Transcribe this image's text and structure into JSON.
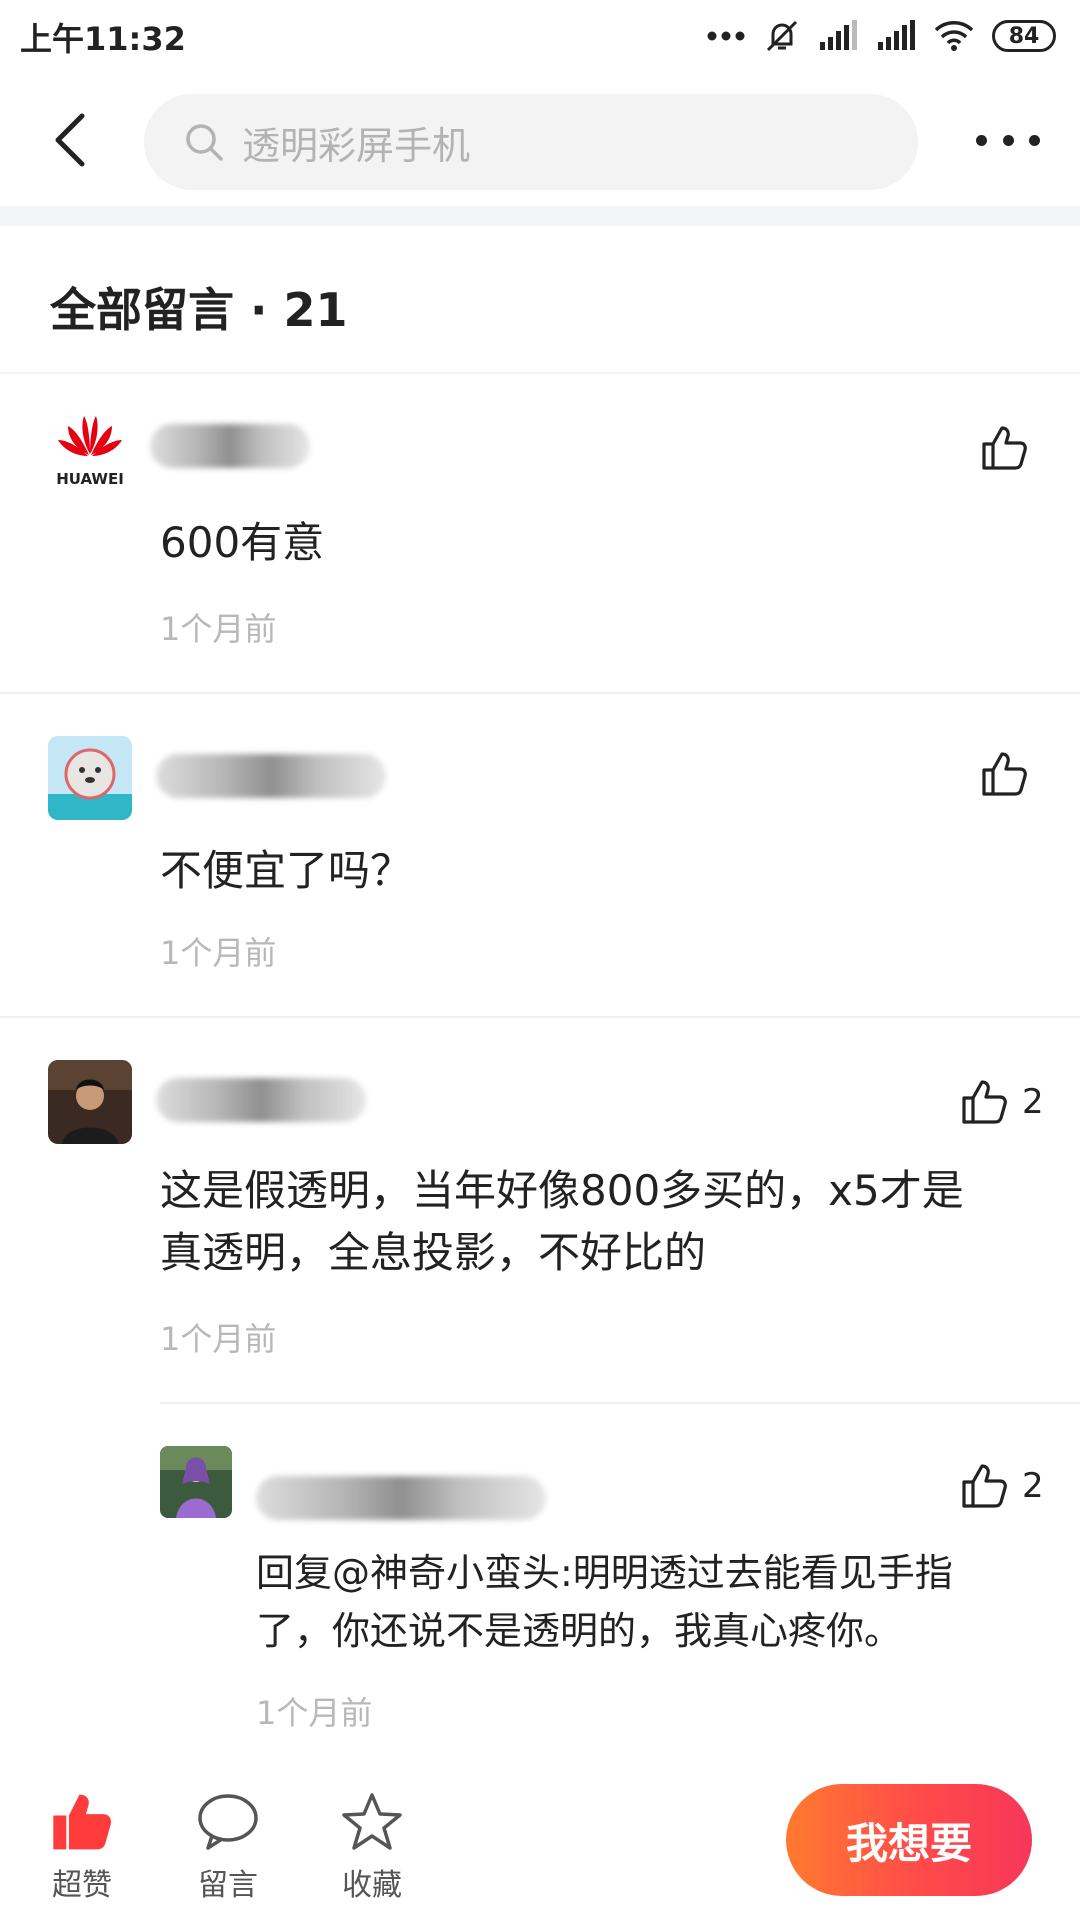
{
  "status_bar": {
    "time": "上午11:32",
    "battery": "84",
    "icons": [
      "more-dots-icon",
      "bell-off-icon",
      "signal-icon",
      "signal-icon",
      "wifi-icon",
      "battery-icon"
    ]
  },
  "header": {
    "search_placeholder": "透明彩屏手机"
  },
  "comments_section": {
    "title": "全部留言 · 21"
  },
  "comments": [
    {
      "avatar": "huawei-logo",
      "avatar_text": "HUAWEI",
      "text": "600有意",
      "time": "1个月前",
      "likes": ""
    },
    {
      "avatar": "seal-avatar",
      "text": "不便宜了吗？",
      "time": "1个月前",
      "likes": ""
    },
    {
      "avatar": "photo-avatar",
      "text_line1": "这是假透明，当年好像800多买的，x5才是",
      "text_line2": "真透明，全息投影，不好比的",
      "time": "1个月前",
      "likes": "2"
    },
    {
      "avatar": "game-avatar",
      "text_line1": "回复@神奇小蛮头:明明透过去能看见手指",
      "text_line2": "了，你还说不是透明的，我真心疼你。",
      "time": "1个月前",
      "likes": "2"
    }
  ],
  "bottom_bar": {
    "tabs": [
      {
        "label": "超赞",
        "icon": "thumbs-up-filled-icon"
      },
      {
        "label": "留言",
        "icon": "speech-bubble-icon"
      },
      {
        "label": "收藏",
        "icon": "star-icon"
      }
    ],
    "want_button": "我想要"
  },
  "colors": {
    "accent_red": "#f5375a",
    "accent_orange": "#ff7a2f",
    "like_red": "#ff3b3b"
  }
}
